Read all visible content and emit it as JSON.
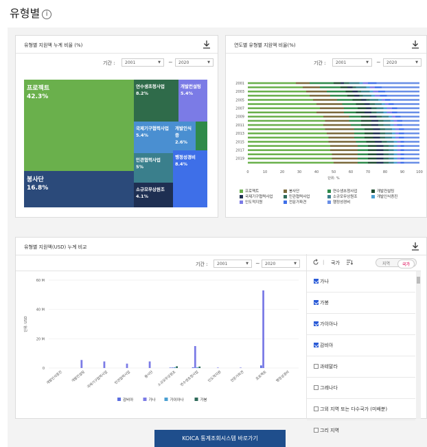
{
  "page": {
    "title": "유형별",
    "info_icon": "i"
  },
  "panel1": {
    "title": "유형별 지원액 누계 비율 (%)",
    "period_label": "기간 :",
    "from": "2001",
    "to": "2020",
    "tilde": "~",
    "treemap": [
      {
        "name": "프로젝트",
        "pct": "42.3%",
        "color": "#6ab04c"
      },
      {
        "name": "봉사단",
        "pct": "16.8%",
        "color": "#2b4a7a"
      },
      {
        "name": "연수생초청사업",
        "pct": "8.2%",
        "color": "#2f6b4a"
      },
      {
        "name": "개발컨설팅",
        "pct": "5.4%",
        "color": "#7b7be6"
      },
      {
        "name": "국제기구협력사업",
        "pct": "5.4%",
        "color": "#4a8fd1"
      },
      {
        "name": "개발인식증",
        "pct": "2.6%",
        "color": "#4a8fd1"
      },
      {
        "name": "민관협력사업",
        "pct": "5%",
        "color": "#3a7f8c"
      },
      {
        "name": "행정성경비",
        "pct": "8.4%",
        "color": "#3e6fe8"
      },
      {
        "name": "소규모무상원조",
        "pct": "4.1%",
        "color": "#1e2f52"
      }
    ]
  },
  "panel2": {
    "title": "연도별 유형별 지원액 비율(%)",
    "period_label": "기간 :",
    "from": "2001",
    "to": "2020",
    "tilde": "~",
    "unit": "단위: %"
  },
  "panel3": {
    "title": "유형별 지원액(USD) 누계 비교",
    "period_label": "기간 :",
    "from": "2001",
    "to": "2020",
    "tilde": "~",
    "ylabel": "단위: USD",
    "country_label": "국가",
    "toggle": {
      "region": "지역",
      "country": "국가"
    },
    "countries": [
      {
        "name": "가나",
        "checked": true
      },
      {
        "name": "가봉",
        "checked": true
      },
      {
        "name": "가이아나",
        "checked": true
      },
      {
        "name": "감비아",
        "checked": true
      },
      {
        "name": "과테말라",
        "checked": false
      },
      {
        "name": "그레나다",
        "checked": false
      },
      {
        "name": "그외 지역 또는 다수국가 (미배분)",
        "checked": false
      },
      {
        "name": "그리 지역",
        "checked": false
      }
    ]
  },
  "button": {
    "label": "KOICA 통계조회시스템 바로가기"
  },
  "chart_data": [
    {
      "type": "treemap",
      "title": "유형별 지원액 누계 비율 (%)",
      "labels": [
        "프로젝트",
        "봉사단",
        "연수생초청사업",
        "개발컨설팅",
        "국제기구협력사업",
        "개발인식증",
        "민관협력사업",
        "행정성경비",
        "소규모무상원조"
      ],
      "values": [
        42.3,
        16.8,
        8.2,
        5.4,
        5.4,
        2.6,
        5,
        8.4,
        4.1
      ]
    },
    {
      "type": "bar",
      "stacked": true,
      "orientation": "horizontal",
      "title": "연도별 유형별 지원액 비율(%)",
      "y_ticks": [
        "2001",
        "2003",
        "2005",
        "2007",
        "2009",
        "2011",
        "2013",
        "2015",
        "2017",
        "2019"
      ],
      "x_ticks": [
        "0",
        "10",
        "20",
        "30",
        "40",
        "50",
        "60",
        "70",
        "80",
        "90",
        "100"
      ],
      "xlabel": "단위: %",
      "xlim": [
        0,
        100
      ],
      "series": [
        {
          "name": "프로젝트",
          "color": "#6ab04c"
        },
        {
          "name": "봉사단",
          "color": "#7a6a3c"
        },
        {
          "name": "연수생초청사업",
          "color": "#2f8a4a"
        },
        {
          "name": "개발컨설팅",
          "color": "#1e4d30"
        },
        {
          "name": "국제기구협력사업",
          "color": "#1e2f52"
        },
        {
          "name": "민관협력사업",
          "color": "#2f6b5a"
        },
        {
          "name": "소규모무상원조",
          "color": "#3a7f8c"
        },
        {
          "name": "개발인식증진",
          "color": "#4a9fd1"
        },
        {
          "name": "인도적지원",
          "color": "#7b7be6"
        },
        {
          "name": "전문가파견",
          "color": "#3e6fe8"
        },
        {
          "name": "행정성경비",
          "color": "#6a8fe6"
        }
      ],
      "rows": [
        [
          28,
          8,
          14,
          4,
          2,
          3,
          6,
          2,
          3,
          5,
          25
        ],
        [
          32,
          10,
          12,
          4,
          3,
          2,
          6,
          2,
          3,
          4,
          22
        ],
        [
          34,
          12,
          11,
          4,
          3,
          2,
          5,
          2,
          3,
          4,
          20
        ],
        [
          36,
          12,
          10,
          4,
          3,
          2,
          5,
          2,
          3,
          4,
          19
        ],
        [
          38,
          14,
          9,
          5,
          3,
          2,
          5,
          2,
          2,
          3,
          17
        ],
        [
          40,
          15,
          8,
          5,
          3,
          3,
          4,
          2,
          2,
          3,
          15
        ],
        [
          42,
          14,
          8,
          5,
          3,
          3,
          4,
          2,
          3,
          3,
          13
        ],
        [
          40,
          16,
          7,
          5,
          4,
          3,
          4,
          2,
          3,
          3,
          13
        ],
        [
          44,
          15,
          7,
          5,
          4,
          3,
          4,
          2,
          2,
          3,
          11
        ],
        [
          45,
          14,
          7,
          6,
          4,
          3,
          4,
          2,
          2,
          3,
          10
        ],
        [
          44,
          16,
          6,
          6,
          4,
          3,
          4,
          2,
          2,
          3,
          10
        ],
        [
          45,
          17,
          6,
          5,
          4,
          3,
          4,
          2,
          2,
          3,
          9
        ],
        [
          46,
          16,
          6,
          5,
          4,
          3,
          4,
          2,
          2,
          3,
          9
        ],
        [
          47,
          15,
          6,
          5,
          4,
          3,
          4,
          2,
          2,
          3,
          9
        ],
        [
          47,
          16,
          6,
          5,
          4,
          3,
          4,
          2,
          2,
          2,
          9
        ],
        [
          48,
          16,
          6,
          5,
          4,
          3,
          3,
          2,
          2,
          2,
          9
        ],
        [
          48,
          16,
          6,
          5,
          4,
          3,
          3,
          2,
          2,
          2,
          9
        ],
        [
          49,
          15,
          6,
          5,
          4,
          3,
          3,
          2,
          2,
          2,
          9
        ],
        [
          49,
          15,
          6,
          5,
          4,
          3,
          3,
          2,
          2,
          2,
          9
        ],
        [
          50,
          14,
          6,
          5,
          4,
          3,
          3,
          2,
          2,
          2,
          9
        ]
      ]
    },
    {
      "type": "bar",
      "title": "유형별 지원액(USD) 누계 비교",
      "categories": [
        "개발인식증진",
        "개발컨설팅",
        "국제기구협력사업",
        "민관협력사업",
        "봉사단",
        "소규모무상원조",
        "연수생초청사업",
        "인도적지원",
        "전문가파견",
        "프로젝트",
        "행정성경비"
      ],
      "y_ticks": [
        "0",
        "20 M",
        "40 M",
        "60 M"
      ],
      "ylabel": "단위: USD",
      "ylim": [
        0,
        60000000
      ],
      "series": [
        {
          "name": "감비아",
          "color": "#5b6ee0",
          "values": [
            0,
            0,
            0,
            0,
            0,
            300000,
            500000,
            0,
            0,
            1800000,
            0
          ]
        },
        {
          "name": "가나",
          "color": "#7b7be6",
          "values": [
            0,
            5500000,
            4500000,
            3000000,
            4500000,
            400000,
            15000000,
            300000,
            300000,
            53000000,
            0
          ]
        },
        {
          "name": "가이아나",
          "color": "#4a9fd1",
          "values": [
            0,
            0,
            0,
            0,
            0,
            500000,
            500000,
            0,
            0,
            0,
            0
          ]
        },
        {
          "name": "가봉",
          "color": "#2f6b5a",
          "values": [
            0,
            0,
            0,
            0,
            0,
            1200000,
            1000000,
            0,
            0,
            0,
            0
          ]
        }
      ]
    }
  ]
}
